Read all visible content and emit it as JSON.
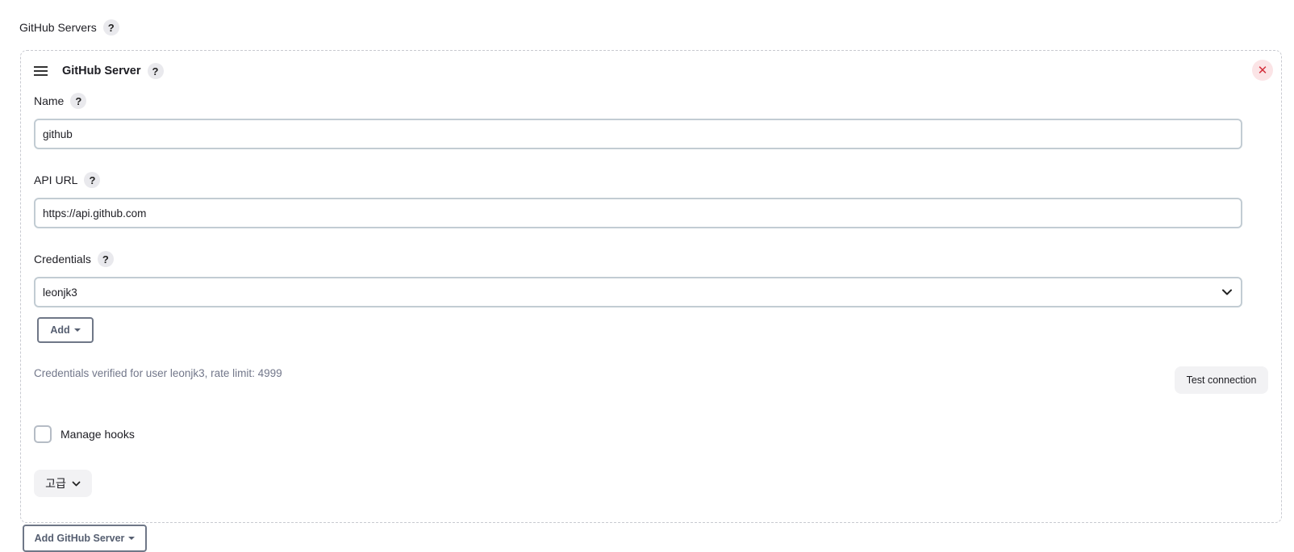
{
  "section": {
    "label": "GitHub Servers",
    "help": "?"
  },
  "server": {
    "title": "GitHub Server",
    "help": "?",
    "remove": "✕",
    "name": {
      "label": "Name",
      "help": "?",
      "value": "github"
    },
    "api_url": {
      "label": "API URL",
      "help": "?",
      "value": "https://api.github.com"
    },
    "credentials": {
      "label": "Credentials",
      "help": "?",
      "selected": "leonjk3",
      "add_label": "Add"
    },
    "status": "Credentials verified for user leonjk3, rate limit: 4999",
    "test_connection": "Test connection",
    "manage_hooks": {
      "label": "Manage hooks",
      "checked": false
    },
    "advanced": "고급"
  },
  "add_server": "Add GitHub Server",
  "icons": {
    "menu": "hamburger-icon",
    "close": "close-icon",
    "select": "chevron-down-icon",
    "advanced": "chevron-down-icon",
    "dropdown": "caret-down-icon"
  },
  "colors": {
    "close_bg": "#fbe4e6",
    "close_fg": "#d32f3b",
    "status_text": "#72778a",
    "input_border": "#c2ccd3"
  }
}
